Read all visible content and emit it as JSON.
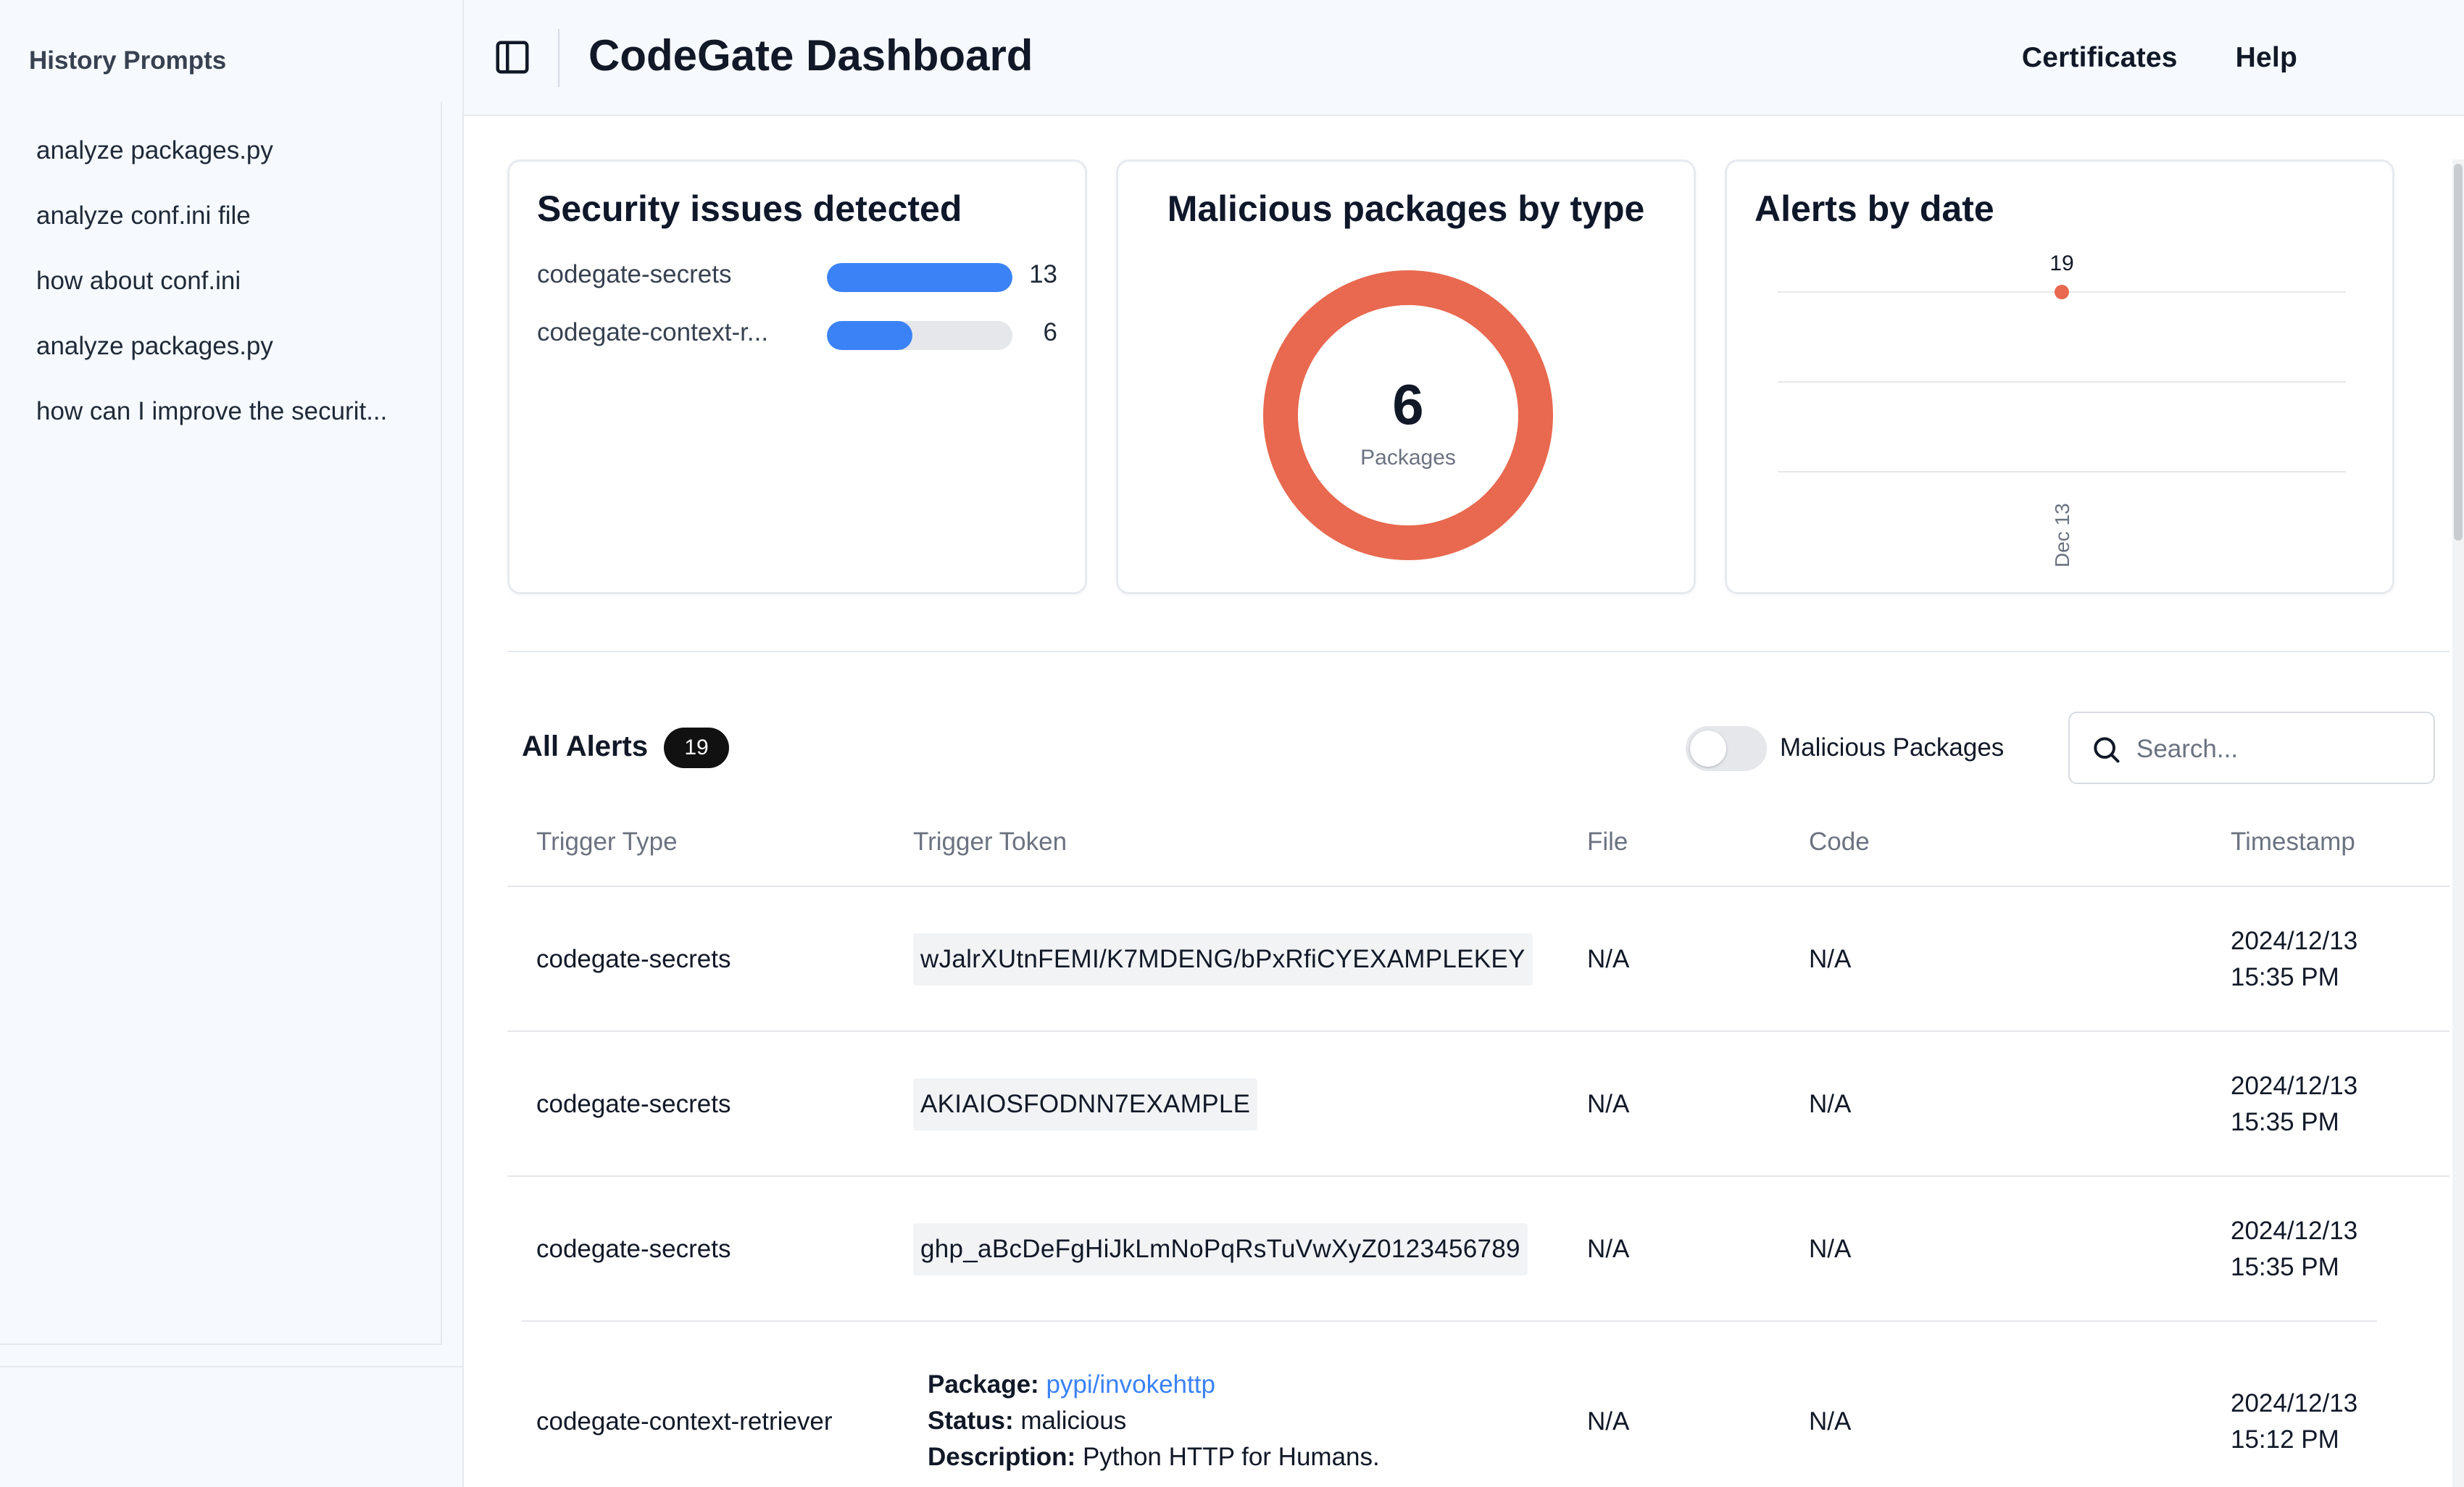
{
  "sidebar": {
    "title": "History Prompts",
    "items": [
      {
        "label": "analyze packages.py"
      },
      {
        "label": "analyze conf.ini file"
      },
      {
        "label": "how about conf.ini"
      },
      {
        "label": "analyze packages.py"
      },
      {
        "label": "how can I improve the securit..."
      }
    ]
  },
  "header": {
    "title": "CodeGate Dashboard",
    "links": [
      "Certificates",
      "Help"
    ],
    "toggle_icon": "sidebar-panel-icon"
  },
  "cards": {
    "security": {
      "title": "Security issues detected",
      "rows": [
        {
          "label": "codegate-secrets",
          "count": "13",
          "value": 13
        },
        {
          "label": "codegate-context-r...",
          "count": "6",
          "value": 6
        }
      ],
      "max": 13
    },
    "malicious": {
      "title": "Malicious packages by type",
      "total": "6",
      "unit": "Packages",
      "color": "#e8694f"
    },
    "alerts_by_date": {
      "title": "Alerts by date"
    }
  },
  "chart_data": {
    "type": "line",
    "title": "Alerts by date",
    "x": [
      "Dec 13"
    ],
    "series": [
      {
        "values": [
          19
        ]
      }
    ],
    "data_labels": [
      "19"
    ],
    "grid": true,
    "color": "#e8694f"
  },
  "alerts": {
    "title": "All Alerts",
    "count": "19",
    "toggle_label": "Malicious Packages",
    "toggle_on": false,
    "search_placeholder": "Search...",
    "columns": [
      "Trigger Type",
      "Trigger Token",
      "File",
      "Code",
      "Timestamp"
    ],
    "rows": [
      {
        "type": "codegate-secrets",
        "token": "wJalrXUtnFEMI/K7MDENG/bPxRfiCYEXAMPLEKEY",
        "file": "N/A",
        "code": "N/A",
        "date": "2024/12/13",
        "time": "15:35 PM"
      },
      {
        "type": "codegate-secrets",
        "token": "AKIAIOSFODNN7EXAMPLE",
        "file": "N/A",
        "code": "N/A",
        "date": "2024/12/13",
        "time": "15:35 PM"
      },
      {
        "type": "codegate-secrets",
        "token": "ghp_aBcDeFgHiJkLmNoPqRsTuVwXyZ0123456789",
        "file": "N/A",
        "code": "N/A",
        "date": "2024/12/13",
        "time": "15:35 PM"
      },
      {
        "type": "codegate-context-retriever",
        "package_label": "Package:",
        "package": "pypi/invokehttp",
        "status_label": "Status:",
        "status": "malicious",
        "description_label": "Description:",
        "description": "Python HTTP for Humans.",
        "file": "N/A",
        "code": "N/A",
        "date": "2024/12/13",
        "time": "15:12 PM"
      }
    ]
  },
  "colors": {
    "accent": "#3b82f6",
    "danger": "#e8694f",
    "sidebar_bg": "#f6f9fd"
  }
}
